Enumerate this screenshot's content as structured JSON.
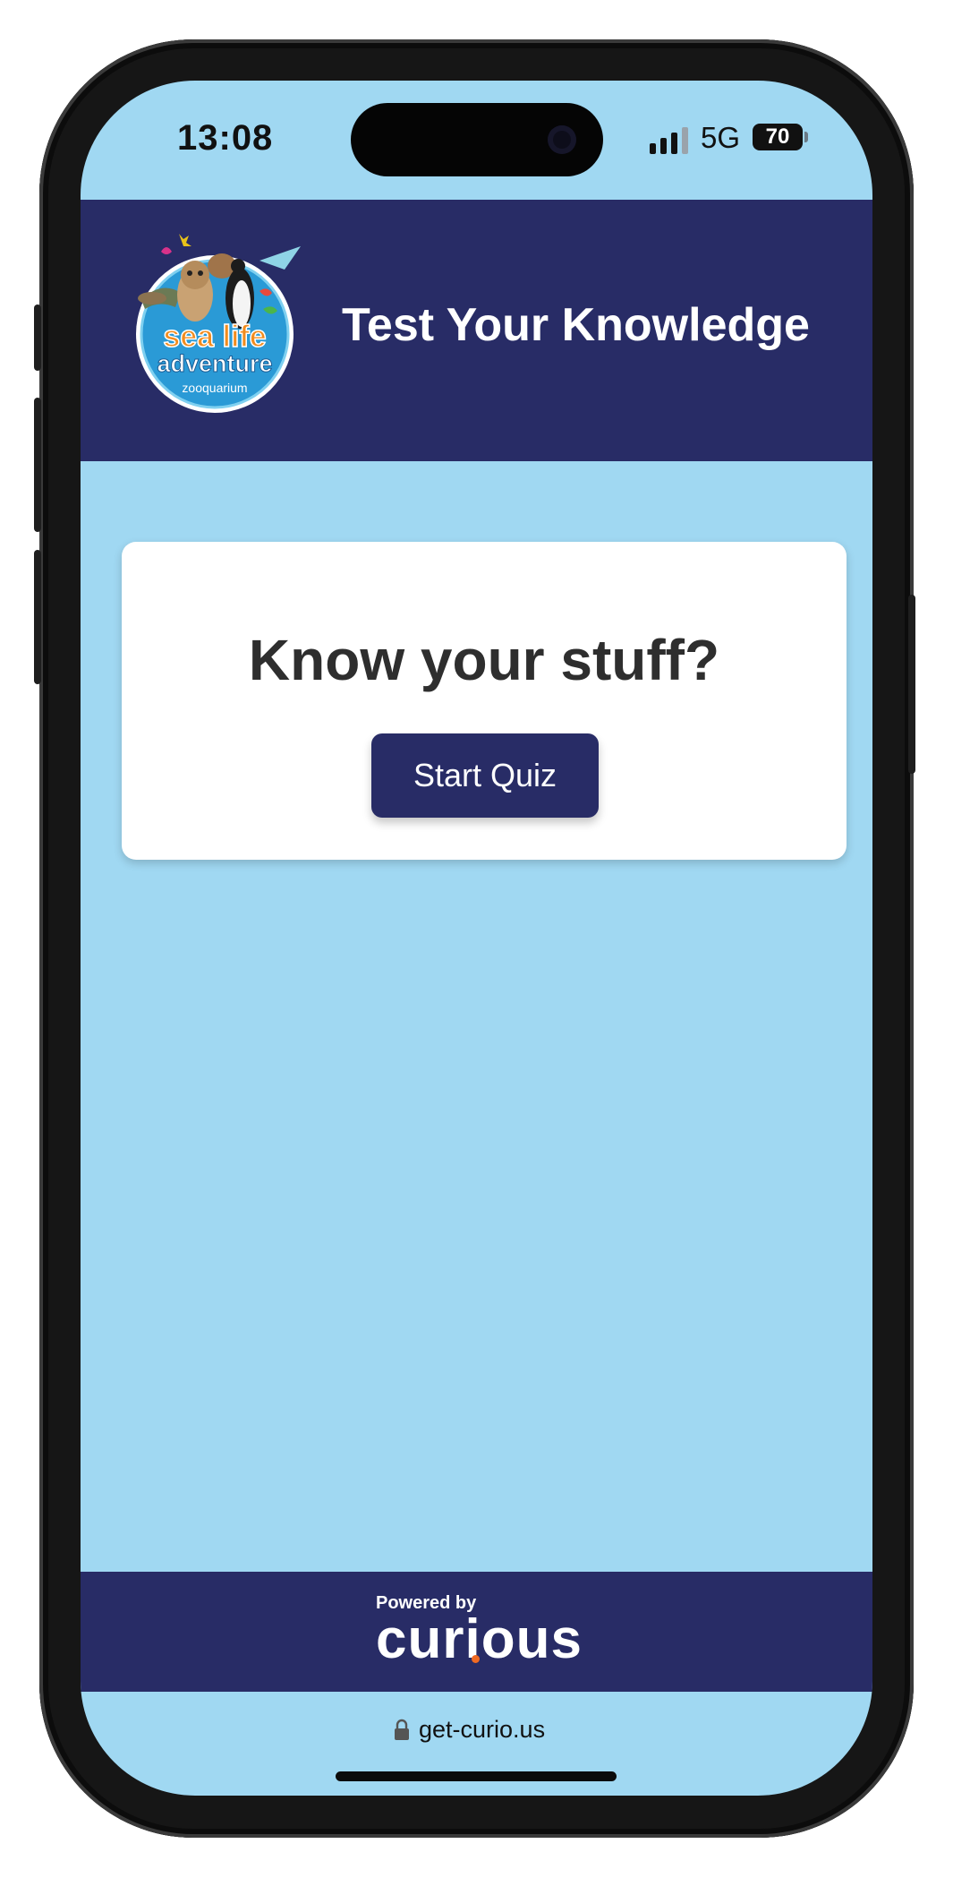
{
  "status_bar": {
    "time": "13:08",
    "network": "5G",
    "battery": "70"
  },
  "header": {
    "logo": {
      "line1": "sea life",
      "line2": "adventure",
      "line3": "zooquarium"
    },
    "title": "Test Your Knowledge"
  },
  "card": {
    "heading": "Know your stuff?",
    "button_label": "Start Quiz"
  },
  "footer": {
    "powered_by": "Powered by",
    "brand": "curious"
  },
  "url_bar": {
    "url": "get-curio.us"
  },
  "colors": {
    "page_background": "#a0d8f2",
    "navy": "#282c66",
    "accent_orange": "#f06a22"
  },
  "icons": [
    "signal-icon",
    "battery-icon",
    "lock-icon",
    "camera-icon"
  ]
}
